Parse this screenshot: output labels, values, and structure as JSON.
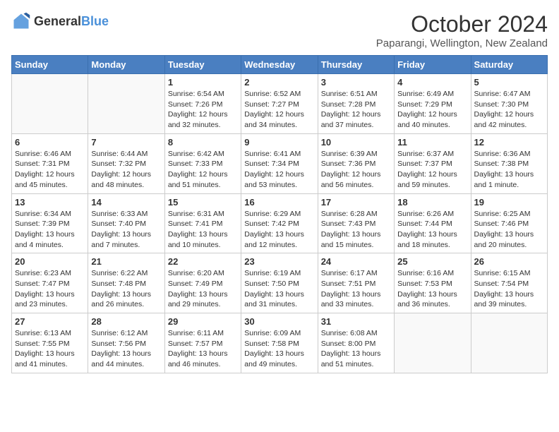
{
  "logo": {
    "general": "General",
    "blue": "Blue"
  },
  "title": {
    "month": "October 2024",
    "location": "Paparangi, Wellington, New Zealand"
  },
  "weekdays": [
    "Sunday",
    "Monday",
    "Tuesday",
    "Wednesday",
    "Thursday",
    "Friday",
    "Saturday"
  ],
  "weeks": [
    [
      {
        "day": "",
        "info": ""
      },
      {
        "day": "",
        "info": ""
      },
      {
        "day": "1",
        "info": "Sunrise: 6:54 AM\nSunset: 7:26 PM\nDaylight: 12 hours and 32 minutes."
      },
      {
        "day": "2",
        "info": "Sunrise: 6:52 AM\nSunset: 7:27 PM\nDaylight: 12 hours and 34 minutes."
      },
      {
        "day": "3",
        "info": "Sunrise: 6:51 AM\nSunset: 7:28 PM\nDaylight: 12 hours and 37 minutes."
      },
      {
        "day": "4",
        "info": "Sunrise: 6:49 AM\nSunset: 7:29 PM\nDaylight: 12 hours and 40 minutes."
      },
      {
        "day": "5",
        "info": "Sunrise: 6:47 AM\nSunset: 7:30 PM\nDaylight: 12 hours and 42 minutes."
      }
    ],
    [
      {
        "day": "6",
        "info": "Sunrise: 6:46 AM\nSunset: 7:31 PM\nDaylight: 12 hours and 45 minutes."
      },
      {
        "day": "7",
        "info": "Sunrise: 6:44 AM\nSunset: 7:32 PM\nDaylight: 12 hours and 48 minutes."
      },
      {
        "day": "8",
        "info": "Sunrise: 6:42 AM\nSunset: 7:33 PM\nDaylight: 12 hours and 51 minutes."
      },
      {
        "day": "9",
        "info": "Sunrise: 6:41 AM\nSunset: 7:34 PM\nDaylight: 12 hours and 53 minutes."
      },
      {
        "day": "10",
        "info": "Sunrise: 6:39 AM\nSunset: 7:36 PM\nDaylight: 12 hours and 56 minutes."
      },
      {
        "day": "11",
        "info": "Sunrise: 6:37 AM\nSunset: 7:37 PM\nDaylight: 12 hours and 59 minutes."
      },
      {
        "day": "12",
        "info": "Sunrise: 6:36 AM\nSunset: 7:38 PM\nDaylight: 13 hours and 1 minute."
      }
    ],
    [
      {
        "day": "13",
        "info": "Sunrise: 6:34 AM\nSunset: 7:39 PM\nDaylight: 13 hours and 4 minutes."
      },
      {
        "day": "14",
        "info": "Sunrise: 6:33 AM\nSunset: 7:40 PM\nDaylight: 13 hours and 7 minutes."
      },
      {
        "day": "15",
        "info": "Sunrise: 6:31 AM\nSunset: 7:41 PM\nDaylight: 13 hours and 10 minutes."
      },
      {
        "day": "16",
        "info": "Sunrise: 6:29 AM\nSunset: 7:42 PM\nDaylight: 13 hours and 12 minutes."
      },
      {
        "day": "17",
        "info": "Sunrise: 6:28 AM\nSunset: 7:43 PM\nDaylight: 13 hours and 15 minutes."
      },
      {
        "day": "18",
        "info": "Sunrise: 6:26 AM\nSunset: 7:44 PM\nDaylight: 13 hours and 18 minutes."
      },
      {
        "day": "19",
        "info": "Sunrise: 6:25 AM\nSunset: 7:46 PM\nDaylight: 13 hours and 20 minutes."
      }
    ],
    [
      {
        "day": "20",
        "info": "Sunrise: 6:23 AM\nSunset: 7:47 PM\nDaylight: 13 hours and 23 minutes."
      },
      {
        "day": "21",
        "info": "Sunrise: 6:22 AM\nSunset: 7:48 PM\nDaylight: 13 hours and 26 minutes."
      },
      {
        "day": "22",
        "info": "Sunrise: 6:20 AM\nSunset: 7:49 PM\nDaylight: 13 hours and 29 minutes."
      },
      {
        "day": "23",
        "info": "Sunrise: 6:19 AM\nSunset: 7:50 PM\nDaylight: 13 hours and 31 minutes."
      },
      {
        "day": "24",
        "info": "Sunrise: 6:17 AM\nSunset: 7:51 PM\nDaylight: 13 hours and 33 minutes."
      },
      {
        "day": "25",
        "info": "Sunrise: 6:16 AM\nSunset: 7:53 PM\nDaylight: 13 hours and 36 minutes."
      },
      {
        "day": "26",
        "info": "Sunrise: 6:15 AM\nSunset: 7:54 PM\nDaylight: 13 hours and 39 minutes."
      }
    ],
    [
      {
        "day": "27",
        "info": "Sunrise: 6:13 AM\nSunset: 7:55 PM\nDaylight: 13 hours and 41 minutes."
      },
      {
        "day": "28",
        "info": "Sunrise: 6:12 AM\nSunset: 7:56 PM\nDaylight: 13 hours and 44 minutes."
      },
      {
        "day": "29",
        "info": "Sunrise: 6:11 AM\nSunset: 7:57 PM\nDaylight: 13 hours and 46 minutes."
      },
      {
        "day": "30",
        "info": "Sunrise: 6:09 AM\nSunset: 7:58 PM\nDaylight: 13 hours and 49 minutes."
      },
      {
        "day": "31",
        "info": "Sunrise: 6:08 AM\nSunset: 8:00 PM\nDaylight: 13 hours and 51 minutes."
      },
      {
        "day": "",
        "info": ""
      },
      {
        "day": "",
        "info": ""
      }
    ]
  ]
}
